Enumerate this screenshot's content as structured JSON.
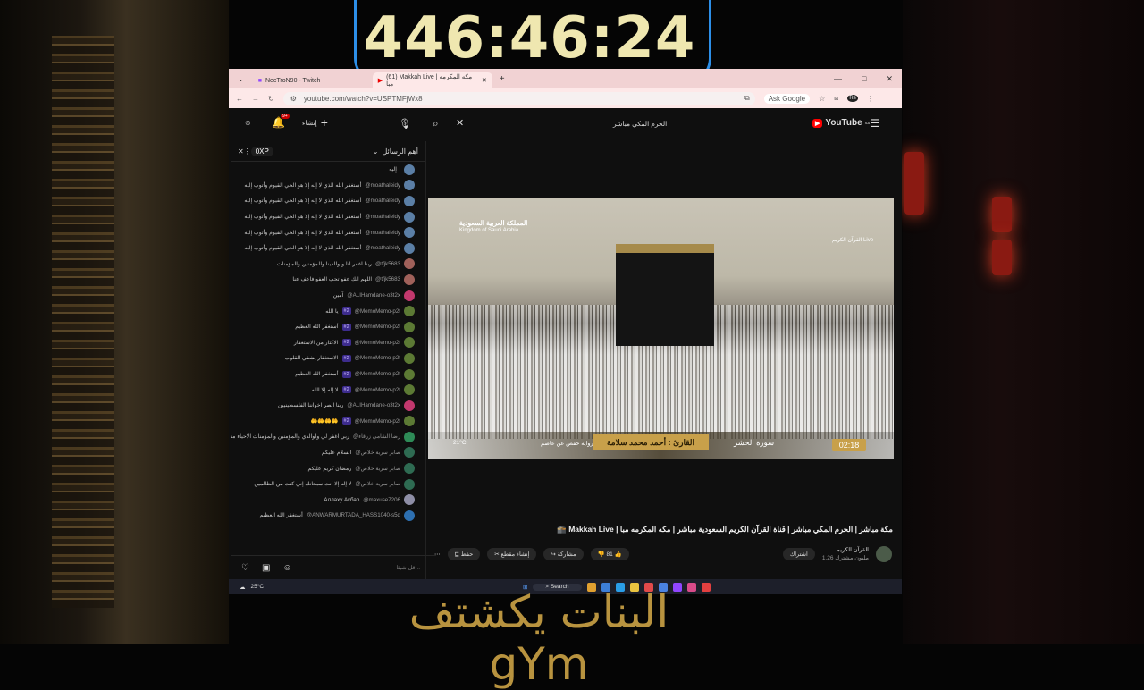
{
  "overlay": {
    "timer": "446:46:24",
    "caption": "البنات يكشتف gYm"
  },
  "browser": {
    "tabs": [
      {
        "label": "NecTroN90 - Twitch"
      },
      {
        "label": "(61) Makkah Live | مكه المكرمه مبا"
      }
    ],
    "url": "youtube.com/watch?v=USPTMFjWx8",
    "ask_google": "Ask Google",
    "profile": "Re"
  },
  "youtube": {
    "logo": "YouTube",
    "country": "SA",
    "search_query": "الحرم المكي مباشر",
    "create_label": "إنشاء",
    "notif_count": "9+"
  },
  "chat": {
    "header": "أهم الرسائل",
    "xp": "0XP",
    "messages": [
      {
        "author": "",
        "text": "إليه",
        "color": "#5b7fa6"
      },
      {
        "author": "@moathaleidy",
        "text": "أستغفر الله الذي لا إله إلا هو الحي القيوم وأتوب إليه",
        "color": "#5b7fa6"
      },
      {
        "author": "@moathaleidy",
        "text": "أستغفر الله الذي لا إله إلا هو الحي القيوم وأتوب إليه",
        "color": "#5b7fa6"
      },
      {
        "author": "@moathaleidy",
        "text": "أستغفر الله الذي لا إله إلا هو الحي القيوم وأتوب إليه",
        "color": "#5b7fa6"
      },
      {
        "author": "@moathaleidy",
        "text": "أستغفر الله الذي لا إله إلا هو الحي القيوم وأتوب إليه",
        "color": "#5b7fa6"
      },
      {
        "author": "@moathaleidy",
        "text": "أستغفر الله الذي لا إله إلا هو الحي القيوم وأتوب إليه",
        "color": "#5b7fa6"
      },
      {
        "author": "@tfjk5683",
        "text": "ربنا اغفر لنا ولوالدينا وللمؤمنين والمؤمنات",
        "color": "#a0615a"
      },
      {
        "author": "@tfjk5683",
        "text": "اللهم انك عفو تحب العفو فاعف عنا",
        "color": "#a0615a"
      },
      {
        "author": "@ALIHamdane-o3t2x",
        "text": "آمين",
        "color": "#c2386d"
      },
      {
        "author": "@MemoMemo-p2t",
        "text": "يا الله",
        "color": "#5c7a34",
        "badge": "#2"
      },
      {
        "author": "@MemoMemo-p2t",
        "text": "أستغفر الله العظيم",
        "color": "#5c7a34",
        "badge": "#2"
      },
      {
        "author": "@MemoMemo-p2t",
        "text": "الاكثار من الاستغفار",
        "color": "#5c7a34",
        "badge": "#2"
      },
      {
        "author": "@MemoMemo-p2t",
        "text": "الاستغفار يشفي القلوب",
        "color": "#5c7a34",
        "badge": "#2"
      },
      {
        "author": "@MemoMemo-p2t",
        "text": "أستغفر الله العظيم",
        "color": "#5c7a34",
        "badge": "#2"
      },
      {
        "author": "@MemoMemo-p2t",
        "text": "لا إله إلا الله",
        "color": "#5c7a34",
        "badge": "#2"
      },
      {
        "author": "@ALIHamdane-o3t2x",
        "text": "ربنا انصر اخواننا الفلسطينيين",
        "color": "#c2386d"
      },
      {
        "author": "@MemoMemo-p2t",
        "text": "🤲🤲🤲🤲",
        "color": "#5c7a34",
        "badge": "#2"
      },
      {
        "author": "@رضا الشامي زرقاء",
        "text": "ربي اغفر لي ولوالدي والمؤمنين والمؤمنات الاحياء منهم والاموات انك انت الغفور الرحيم",
        "color": "#2e8b57"
      },
      {
        "author": "@صابر سرية خلاص",
        "text": "السلام عليكم",
        "color": "#2e6b52"
      },
      {
        "author": "@صابر سرية خلاص",
        "text": "رمضان كريم عليكم",
        "color": "#2e6b52"
      },
      {
        "author": "@صابر سرية خلاص",
        "text": "لا إله إلا أنت سبحانك إني كنت من الظالمين",
        "color": "#2e6b52"
      },
      {
        "author": "@maxuse7206",
        "text": "Аллаху Акбар",
        "color": "#8e8ea6"
      },
      {
        "author": "@ANWARMURTADA_HASS1040-s5d",
        "text": "أستغفر الله العظيم",
        "color": "#2d6fb0"
      }
    ],
    "input_placeholder": "قل شيئا..."
  },
  "video": {
    "channel_overlay": "المملكة العربية السعودية",
    "channel_overlay_en": "Kingdom of Saudi Arabia",
    "quran_live": "القرآن الكريم Live",
    "reciter": "القارئ : أحمد محمد سلامة",
    "surah": "سورة الحشر",
    "riwaya": "رواية حفص عن عاصم",
    "temp": "21°C",
    "clock": "02:18"
  },
  "details": {
    "title": "مكة مباشر | الحرم المكي مباشر | قناة القرآن الكريم السعودية مباشر | مكه المكرمه مبا | Makkah Live 🕋",
    "channel": "القرآن الكريم",
    "subs": "1.26 مليون مشترك",
    "subscribe": "اشتراك",
    "likes": "81",
    "share": "مشاركة",
    "clip": "إنشاء مقطع",
    "save": "حفظ"
  },
  "taskbar": {
    "weather": "25°C",
    "search": "Search"
  }
}
